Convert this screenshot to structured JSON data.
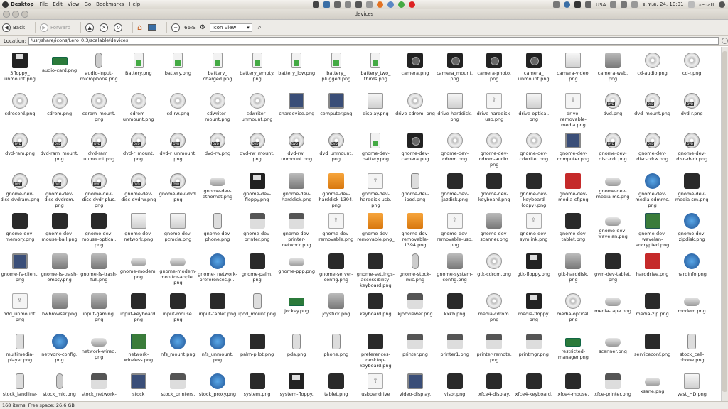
{
  "top_panel": {
    "app_name": "Desktop",
    "menus": [
      "File",
      "Edit",
      "View",
      "Go",
      "Bookmarks",
      "Help"
    ],
    "keyboard_layout": "USA",
    "clock": "จ. พ.ค. 24, 10:01",
    "user": "xenatt"
  },
  "window": {
    "title": "devices"
  },
  "toolbar": {
    "back_label": "Back",
    "forward_label": "Forward",
    "zoom": "66%",
    "view_mode": "Icon View"
  },
  "location": {
    "label": "Location:",
    "path": "/usr/share/icons/Lero_0.3/scalable/devices"
  },
  "status": {
    "text": "168 items, Free space: 26.6 GB"
  },
  "files": [
    {
      "name": "3floppy_ unmount.png",
      "icon": "floppy"
    },
    {
      "name": "audio-card.png",
      "icon": "card"
    },
    {
      "name": "audio-input- microphone.png",
      "icon": "mic"
    },
    {
      "name": "Battery.png",
      "icon": "battery"
    },
    {
      "name": "battery.png",
      "icon": "battery"
    },
    {
      "name": "battery_ charged.png",
      "icon": "battery"
    },
    {
      "name": "battery_empty. png",
      "icon": "battery"
    },
    {
      "name": "battery_low.png",
      "icon": "battery"
    },
    {
      "name": "battery_ plugged.png",
      "icon": "battery"
    },
    {
      "name": "battery_two_ thirds.png",
      "icon": "battery"
    },
    {
      "name": "camera.png",
      "icon": "cam"
    },
    {
      "name": "camera_mount. png",
      "icon": "cam"
    },
    {
      "name": "camera-photo. png",
      "icon": "cam"
    },
    {
      "name": "camera_ unmount.png",
      "icon": "cam"
    },
    {
      "name": "camera-video. png",
      "icon": "drive"
    },
    {
      "name": "camera-web. png",
      "icon": "grey"
    },
    {
      "name": "cd-audio.png",
      "icon": "cd"
    },
    {
      "name": "cd-r.png",
      "icon": "cd"
    },
    {
      "name": "cdrecord.png",
      "icon": "cd"
    },
    {
      "name": "cdrom.png",
      "icon": "cd"
    },
    {
      "name": "cdrom_mount. png",
      "icon": "cd"
    },
    {
      "name": "cdrom_ unmount.png",
      "icon": "cd"
    },
    {
      "name": "cd-rw.png",
      "icon": "cd"
    },
    {
      "name": "cdwriter_ mount.png",
      "icon": "cd"
    },
    {
      "name": "cdwriter_ unmount.png",
      "icon": "cd"
    },
    {
      "name": "chardevice.png",
      "icon": "monitor"
    },
    {
      "name": "computer.png",
      "icon": "monitor"
    },
    {
      "name": "display.png",
      "icon": "drive"
    },
    {
      "name": "drive-cdrom. png",
      "icon": "cd"
    },
    {
      "name": "drive-harddisk. png",
      "icon": "drive"
    },
    {
      "name": "drive-harddisk- usb.png",
      "icon": "usb"
    },
    {
      "name": "drive-optical. png",
      "icon": "drive"
    },
    {
      "name": "drive- removable- media.png",
      "icon": "usb"
    },
    {
      "name": "dvd.png",
      "icon": "dvd"
    },
    {
      "name": "dvd_mount.png",
      "icon": "dvd"
    },
    {
      "name": "dvd-r.png",
      "icon": "dvd"
    },
    {
      "name": "dvd-ram.png",
      "icon": "dvd"
    },
    {
      "name": "dvd-ram_mount. png",
      "icon": "dvd"
    },
    {
      "name": "dvd-ram_ unmount.png",
      "icon": "dvd"
    },
    {
      "name": "dvd-r_mount. png",
      "icon": "dvd"
    },
    {
      "name": "dvd-r_unmount. png",
      "icon": "dvd"
    },
    {
      "name": "dvd-rw.png",
      "icon": "dvd"
    },
    {
      "name": "dvd-rw_mount. png",
      "icon": "dvd"
    },
    {
      "name": "dvd-rw_ unmount.png",
      "icon": "dvd"
    },
    {
      "name": "dvd_unmount. png",
      "icon": "dvd"
    },
    {
      "name": "gnome-dev- battery.png",
      "icon": "battery"
    },
    {
      "name": "gnome-dev- camera.png",
      "icon": "cam"
    },
    {
      "name": "gnome-dev- cdrom.png",
      "icon": "cd"
    },
    {
      "name": "gnome-dev- cdrom-audio. png",
      "icon": "cd"
    },
    {
      "name": "gnome-dev- cdwriter.png",
      "icon": "cd"
    },
    {
      "name": "gnome-dev- computer.png",
      "icon": "monitor"
    },
    {
      "name": "gnome-dev- disc-cdr.png",
      "icon": "dvd"
    },
    {
      "name": "gnome-dev- disc-cdrw.png",
      "icon": "dvd"
    },
    {
      "name": "gnome-dev- disc-dvdr.png",
      "icon": "dvd"
    },
    {
      "name": "gnome-dev- disc-dvdram.png",
      "icon": "dvd"
    },
    {
      "name": "gnome-dev- disc-dvdrom. png",
      "icon": "dvd"
    },
    {
      "name": "gnome-dev- disc-dvdr-plus. png",
      "icon": "dvd"
    },
    {
      "name": "gnome-dev- disc-dvdrw.png",
      "icon": "dvd"
    },
    {
      "name": "gnome-dev-dvd. png",
      "icon": "dvd"
    },
    {
      "name": "gnome-dev- ethernet.png",
      "icon": "wave"
    },
    {
      "name": "gnome-dev- floppy.png",
      "icon": "floppy"
    },
    {
      "name": "gnome-dev- harddisk.png",
      "icon": "grey"
    },
    {
      "name": "gnome-dev- harddisk-1394. png",
      "icon": "orange"
    },
    {
      "name": "gnome-dev- harddisk-usb. png",
      "icon": "usb"
    },
    {
      "name": "gnome-dev- ipod.png",
      "icon": "phone"
    },
    {
      "name": "gnome-dev- jazdisk.png",
      "icon": "dark"
    },
    {
      "name": "gnome-dev- keyboard.png",
      "icon": "dark"
    },
    {
      "name": "gnome-dev- keyboard (copy).png",
      "icon": "dark"
    },
    {
      "name": "gnome-dev- media-cf.png",
      "icon": "red"
    },
    {
      "name": "gnome-dev- media-ms.png",
      "icon": "wave"
    },
    {
      "name": "gnome-dev- media-sdmmc. png",
      "icon": "blue"
    },
    {
      "name": "gnome-dev- media-sm.png",
      "icon": "dark"
    },
    {
      "name": "gnome-dev- memory.png",
      "icon": "dark"
    },
    {
      "name": "gnome-dev- mouse-ball.png",
      "icon": "dark"
    },
    {
      "name": "gnome-dev- mouse-optical. png",
      "icon": "dark"
    },
    {
      "name": "gnome-dev- network.png",
      "icon": "drive"
    },
    {
      "name": "gnome-dev- pcmcia.png",
      "icon": "drive"
    },
    {
      "name": "gnome-dev- phone.png",
      "icon": "phone"
    },
    {
      "name": "gnome-dev- printer.png",
      "icon": "printer"
    },
    {
      "name": "gnome-dev- printer- network.png",
      "icon": "printer"
    },
    {
      "name": "gnome-dev- removable.png",
      "icon": "usb"
    },
    {
      "name": "gnome-dev- removable.png_",
      "icon": "orange"
    },
    {
      "name": "gnome-dev- removable- 1394.png",
      "icon": "orange"
    },
    {
      "name": "gnome-dev- removable-usb. png",
      "icon": "usb"
    },
    {
      "name": "gnome-dev- scanner.png",
      "icon": "grey"
    },
    {
      "name": "gnome-dev- symlink.png",
      "icon": "usb"
    },
    {
      "name": "gnome-dev- tablet.png",
      "icon": "dark"
    },
    {
      "name": "gnome-dev- wavelan.png",
      "icon": "wave"
    },
    {
      "name": "gnome-dev- wavelan- encrypted.png",
      "icon": "green"
    },
    {
      "name": "gnome-dev- zipdisk.png",
      "icon": "blue"
    },
    {
      "name": "gnome-fs-client. png",
      "icon": "monitor"
    },
    {
      "name": "gnome-fs-trash- empty.png",
      "icon": "grey"
    },
    {
      "name": "gnome-fs-trash- full.png",
      "icon": "grey"
    },
    {
      "name": "gnome-modem. png",
      "icon": "wave"
    },
    {
      "name": "gnome-modem- monitor-applet. png",
      "icon": "wave"
    },
    {
      "name": "gnome- network- preferences.p...",
      "icon": "blue"
    },
    {
      "name": "gnome-palm. png",
      "icon": "dark"
    },
    {
      "name": "gnome-ppp.png",
      "icon": "wave"
    },
    {
      "name": "gnome-server- config.png",
      "icon": "dark"
    },
    {
      "name": "gnome-settings- accessibility- keyboard.png",
      "icon": "dark"
    },
    {
      "name": "gnome-stock- mic.png",
      "icon": "mic"
    },
    {
      "name": "gnome-system- config.png",
      "icon": "grey"
    },
    {
      "name": "gtk-cdrom.png",
      "icon": "cd"
    },
    {
      "name": "gtk-floppy.png",
      "icon": "floppy"
    },
    {
      "name": "gtk-harddisk. png",
      "icon": "grey"
    },
    {
      "name": "gvm-dev-tablet. png",
      "icon": "dark"
    },
    {
      "name": "harddrive.png",
      "icon": "red"
    },
    {
      "name": "hardinfo.png",
      "icon": "blue"
    },
    {
      "name": "hdd_unmount. png",
      "icon": "usb"
    },
    {
      "name": "hwbrowser.png",
      "icon": "grey"
    },
    {
      "name": "input-gaming. png",
      "icon": "grey"
    },
    {
      "name": "input-keyboard. png",
      "icon": "dark"
    },
    {
      "name": "input-mouse. png",
      "icon": "dark"
    },
    {
      "name": "input-tablet.png",
      "icon": "dark"
    },
    {
      "name": "ipod_mount.png",
      "icon": "phone"
    },
    {
      "name": "jockey.png",
      "icon": "card"
    },
    {
      "name": "joystick.png",
      "icon": "grey"
    },
    {
      "name": "keyboard.png",
      "icon": "dark"
    },
    {
      "name": "kjobviewer.png",
      "icon": "printer"
    },
    {
      "name": "kxkb.png",
      "icon": "dark"
    },
    {
      "name": "media-cdrom. png",
      "icon": "cd"
    },
    {
      "name": "media-floppy. png",
      "icon": "floppy"
    },
    {
      "name": "media-optical. png",
      "icon": "cd"
    },
    {
      "name": "media-tape.png",
      "icon": "wave"
    },
    {
      "name": "media-zip.png",
      "icon": "dark"
    },
    {
      "name": "modem.png",
      "icon": "wave"
    },
    {
      "name": "multimedia- player.png",
      "icon": "phone"
    },
    {
      "name": "network-config. png",
      "icon": "blue"
    },
    {
      "name": "network-wired. png",
      "icon": "wave"
    },
    {
      "name": "network- wireless.png",
      "icon": "green"
    },
    {
      "name": "nfs_mount.png",
      "icon": "blue"
    },
    {
      "name": "nfs_unmount. png",
      "icon": "blue"
    },
    {
      "name": "palm-pilot.png",
      "icon": "dark"
    },
    {
      "name": "pda.png",
      "icon": "phone"
    },
    {
      "name": "phone.png",
      "icon": "phone"
    },
    {
      "name": "preferences- desktop- keyboard.png",
      "icon": "dark"
    },
    {
      "name": "printer.png",
      "icon": "printer"
    },
    {
      "name": "printer1.png",
      "icon": "printer"
    },
    {
      "name": "printer-remote. png",
      "icon": "printer"
    },
    {
      "name": "printmgr.png",
      "icon": "printer"
    },
    {
      "name": "restricted- manager.png",
      "icon": "card"
    },
    {
      "name": "scanner.png",
      "icon": "wave"
    },
    {
      "name": "serviceconf.png",
      "icon": "dark"
    },
    {
      "name": "stock_cell- phone.png",
      "icon": "phone"
    },
    {
      "name": "stock_landline-",
      "icon": "phone"
    },
    {
      "name": "stock_mic.png",
      "icon": "mic"
    },
    {
      "name": "stock_network-",
      "icon": "printer"
    },
    {
      "name": "stock",
      "icon": "monitor"
    },
    {
      "name": "stock_printers.",
      "icon": "printer"
    },
    {
      "name": "stock_proxy.png",
      "icon": "blue"
    },
    {
      "name": "system.png",
      "icon": "dark"
    },
    {
      "name": "system-floppy.",
      "icon": "floppy"
    },
    {
      "name": "tablet.png",
      "icon": "dark"
    },
    {
      "name": "usbpendrive",
      "icon": "usb"
    },
    {
      "name": "video-display.",
      "icon": "monitor"
    },
    {
      "name": "visor.png",
      "icon": "dark"
    },
    {
      "name": "xfce4-display.",
      "icon": "dark"
    },
    {
      "name": "xfce4-keyboard.",
      "icon": "dark"
    },
    {
      "name": "xfce4-mouse.",
      "icon": "dark"
    },
    {
      "name": "xfce-printer.png",
      "icon": "printer"
    },
    {
      "name": "xsane.png",
      "icon": "wave"
    },
    {
      "name": "yast_HD.png",
      "icon": "drive"
    }
  ]
}
